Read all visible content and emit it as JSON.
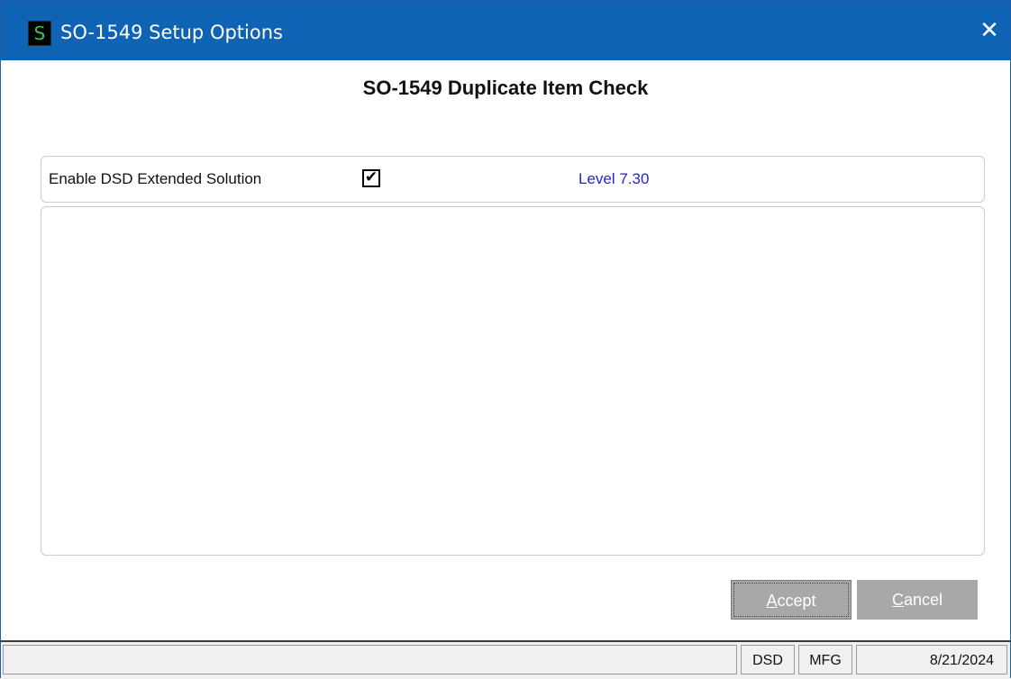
{
  "window": {
    "title": "SO-1549 Setup Options",
    "icon_letter": "S",
    "close_glyph": "✕"
  },
  "heading": "SO-1549 Duplicate Item Check",
  "settings": {
    "enable_label": "Enable DSD Extended Solution",
    "enable_checked": true,
    "check_glyph": "✔",
    "level_label": "Level",
    "level_value": "7.30"
  },
  "buttons": {
    "accept_mnemonic": "A",
    "accept_rest": "ccept",
    "cancel_mnemonic": "C",
    "cancel_rest": "ancel"
  },
  "statusbar": {
    "message": "",
    "cell1": "DSD",
    "cell2": "MFG",
    "date": "8/21/2024"
  },
  "colors": {
    "titlebar": "#0f63b4",
    "level_text": "#2323d9",
    "button_bg": "#a8a8a8"
  },
  "icons": {
    "app": "app-s-icon",
    "close": "close-icon",
    "check": "checkmark-icon"
  }
}
